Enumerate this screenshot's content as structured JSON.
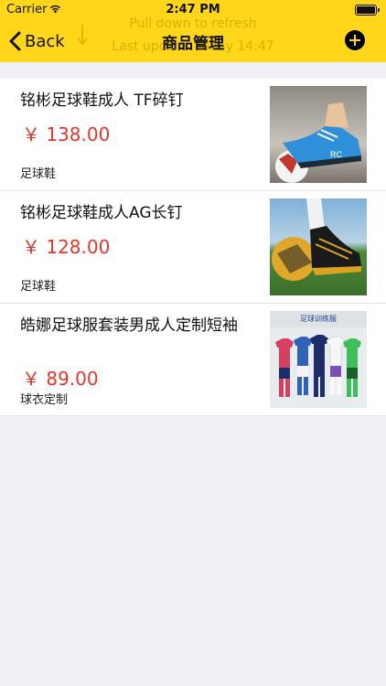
{
  "status_bar": {
    "carrier": "Carrier",
    "time": "2:47 PM"
  },
  "refresh": {
    "line1": "Pull down to refresh",
    "line2": "Last update: Today 14:47"
  },
  "nav": {
    "back_label": "Back",
    "title": "商品管理"
  },
  "colors": {
    "header": "#ffd61a",
    "price": "#e2372a",
    "refresh_text": "#d8b300"
  },
  "products": [
    {
      "name": "铭彬足球鞋成人 TF碎钉",
      "price": "￥ 138.00",
      "category": "足球鞋",
      "image": "blue-soccer-shoe"
    },
    {
      "name": "铭彬足球鞋成人AG长钉",
      "price": "￥ 128.00",
      "category": "足球鞋",
      "image": "black-soccer-shoe"
    },
    {
      "name": "皓娜足球服套装男成人定制短袖",
      "price": "￥ 89.00",
      "category": "球衣定制",
      "image": "soccer-jerseys"
    }
  ],
  "jersey_banner": "足球训练服"
}
